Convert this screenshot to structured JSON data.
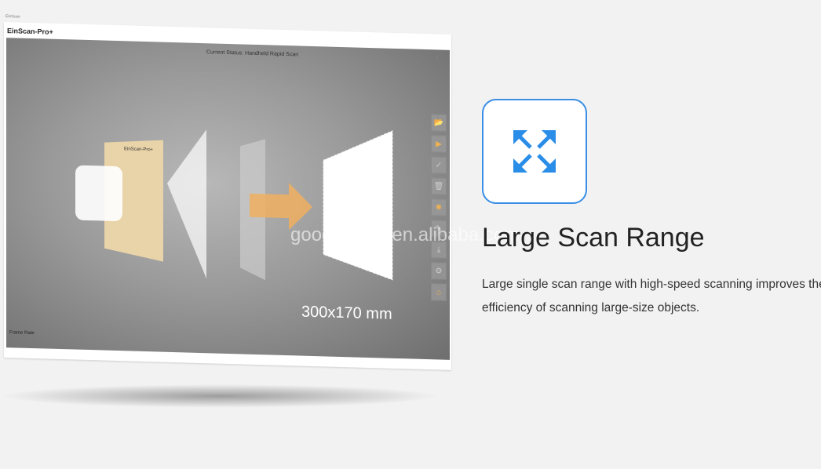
{
  "window": {
    "tiny_title": "EinScan",
    "app_title": "EinScan-Pro+",
    "status": "Current Status: Handheld Rapid Scan",
    "controls": "– ▫ ×",
    "frame_rate_label": "Frame Rate",
    "scan_size": "300x170 mm",
    "device_label": "EinScan-Pro+"
  },
  "toolbar": [
    {
      "icon": "folder-icon",
      "glyph": "📂"
    },
    {
      "icon": "play-icon",
      "glyph": "▶"
    },
    {
      "icon": "check-icon",
      "glyph": "✓"
    },
    {
      "icon": "trash-icon",
      "glyph": "🗑"
    },
    {
      "icon": "brightness-icon",
      "glyph": "✺"
    },
    {
      "icon": "edit-icon",
      "glyph": "✎"
    },
    {
      "icon": "download-icon",
      "glyph": "⤓"
    },
    {
      "icon": "settings-icon",
      "glyph": "⚙"
    },
    {
      "icon": "home-icon",
      "glyph": "⌂"
    }
  ],
  "watermark": "goodcutcnc.en.alibaba.com",
  "feature": {
    "title": "Large Scan Range",
    "description": "Large single scan range with high-speed scanning improves the efficiency of scanning large-size objects.",
    "accent": "#3a8ee6"
  }
}
